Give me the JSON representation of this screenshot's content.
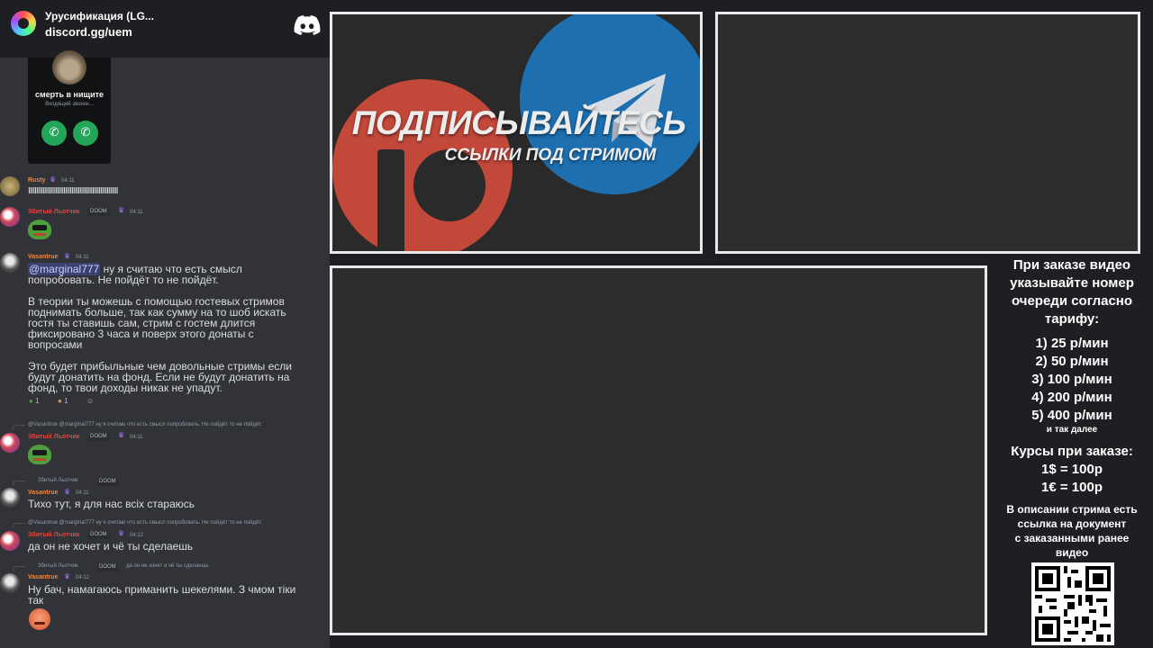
{
  "server": {
    "name": "Урусификация (LG...",
    "invite": "discord.gg/uem",
    "logo_icon": "discord-logo-icon"
  },
  "call": {
    "caller_name": "смерть в нищите",
    "status": "Входящий звонок...",
    "accept_icon": "phone-icon",
    "video_icon": "phone-icon"
  },
  "messages": [
    {
      "author": "Rusty",
      "time": "04:11",
      "text": "IIIIIIIIIIIIIIIIIIIIIIIIIIIIIIIIIIIIIIIIIIIIIIIIIIIIIIII"
    },
    {
      "author": "Збитый Льотчик",
      "tag": "DOOM",
      "time": "04:11"
    },
    {
      "author": "Vasantrue",
      "time": "04:11",
      "mention": "@marginal777",
      "lines": [
        "ну я считаю что есть смысл",
        "попробовать. Не пойдёт то не пойдёт.",
        "В теории ты можешь с помощью гостевых стримов",
        "поднимать больше, так как сумму на то шоб искать",
        "гостя ты ставишь сам, стрим с гостем длится",
        "фиксировано 3 часа и поверх этого донаты с",
        "вопросами",
        "Это будет прибыльные чем довольные стримы если",
        "будут донатить на фонд. Если не будут донатить на",
        "фонд, то твои доходы никак не упадут."
      ],
      "reactions": [
        "1",
        "1"
      ]
    },
    {
      "reply": "@Vasantrue @marginal777 ну я считаю что есть смысл попробовать. Не пойдёт то не пойдёт.",
      "author": "Збитый Льотчик",
      "tag": "DOOM",
      "time": "04:11"
    },
    {
      "reply": "Збитый Льотчик",
      "reply_tag": "DOOM",
      "author": "Vasantrue",
      "time": "04:11",
      "text": "Тихо тут, я для нас всіх стараюсь"
    },
    {
      "reply": "@Vasantrue @marginal777 ну я считаю что есть смысл попробовать. Не пойдёт то не пойдёт.",
      "author": "Збитый Льотчик",
      "tag": "DOOM",
      "time": "04:12",
      "text": "да он не хочет и чё ты сделаешь"
    },
    {
      "reply": "Збитый Льотчик",
      "reply_tag": "DOOM",
      "reply_text": "да он не хочет и чё ты сделаешь",
      "author": "Vasantrue",
      "time": "04:12",
      "text": "Ну бач, намагаюсь приманить шекелями. З чмом тіки",
      "text2": "так"
    }
  ],
  "promo": {
    "title": "ПОДПИСЫВАЙТЕСЬ",
    "subtitle": "ССЫЛКИ ПОД СТРИМОМ"
  },
  "info": {
    "heading": [
      "При заказе видео",
      "указывайте номер",
      "очереди согласно",
      "тарифу:"
    ],
    "tariffs": [
      "1) 25 р/мин",
      "2) 50 р/мин",
      "3) 100 р/мин",
      "4) 200 р/мин",
      "5) 400 р/мин"
    ],
    "etc": "и так далее",
    "rates_heading": "Курсы при заказе:",
    "rates": [
      "1$ = 100р",
      "1€ = 100р"
    ],
    "doc_note": [
      "В описании стрима есть",
      "ссылка на документ",
      "с заказанными ранее",
      "видео"
    ]
  },
  "colors": {
    "discord_bg": "#313338",
    "accent_green": "#23a55a",
    "patreon": "#c2483a",
    "telegram": "#1d6fb0",
    "username_orange": "#f0883e",
    "username_red": "#e0463e"
  }
}
